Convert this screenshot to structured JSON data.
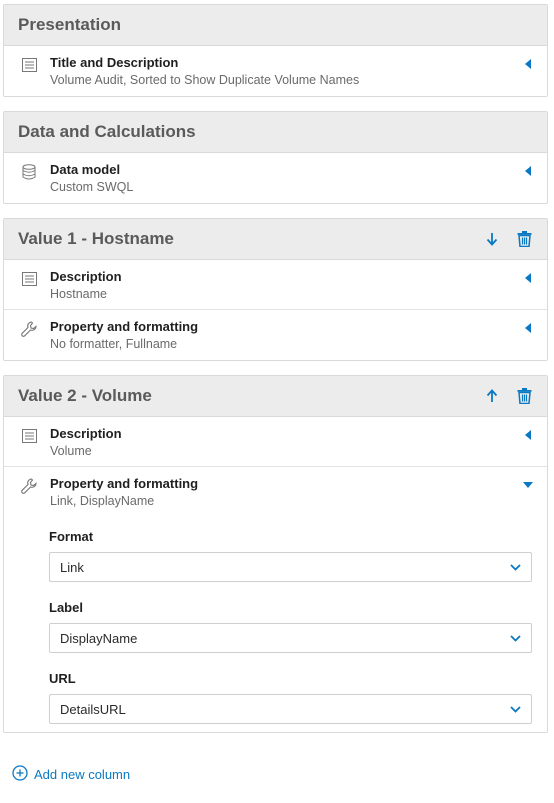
{
  "presentation": {
    "title": "Presentation",
    "rows": [
      {
        "title": "Title and Description",
        "sub": "Volume Audit, Sorted to Show Duplicate Volume Names",
        "icon": "list-icon"
      }
    ]
  },
  "data_calc": {
    "title": "Data and Calculations",
    "rows": [
      {
        "title": "Data model",
        "sub": "Custom SWQL",
        "icon": "database-icon"
      }
    ]
  },
  "value1": {
    "title": "Value 1 - Hostname",
    "move_icon": "arrow-down-icon",
    "delete_icon": "trash-icon",
    "rows": [
      {
        "title": "Description",
        "sub": "Hostname",
        "icon": "list-icon"
      },
      {
        "title": "Property and formatting",
        "sub": "No formatter, Fullname",
        "icon": "wrench-icon"
      }
    ]
  },
  "value2": {
    "title": "Value 2 - Volume",
    "move_icon": "arrow-up-icon",
    "delete_icon": "trash-icon",
    "rows": [
      {
        "title": "Description",
        "sub": "Volume",
        "icon": "list-icon"
      },
      {
        "title": "Property and formatting",
        "sub": "Link, DisplayName",
        "icon": "wrench-icon"
      }
    ],
    "fields": [
      {
        "label": "Format",
        "value": "Link"
      },
      {
        "label": "Label",
        "value": "DisplayName"
      },
      {
        "label": "URL",
        "value": "DetailsURL"
      }
    ]
  },
  "add_column": {
    "label": "Add new column",
    "icon": "plus-circle-icon"
  },
  "colors": {
    "accent": "#0a78c2",
    "header_bg": "#ececec",
    "border": "#d9d9d9"
  }
}
